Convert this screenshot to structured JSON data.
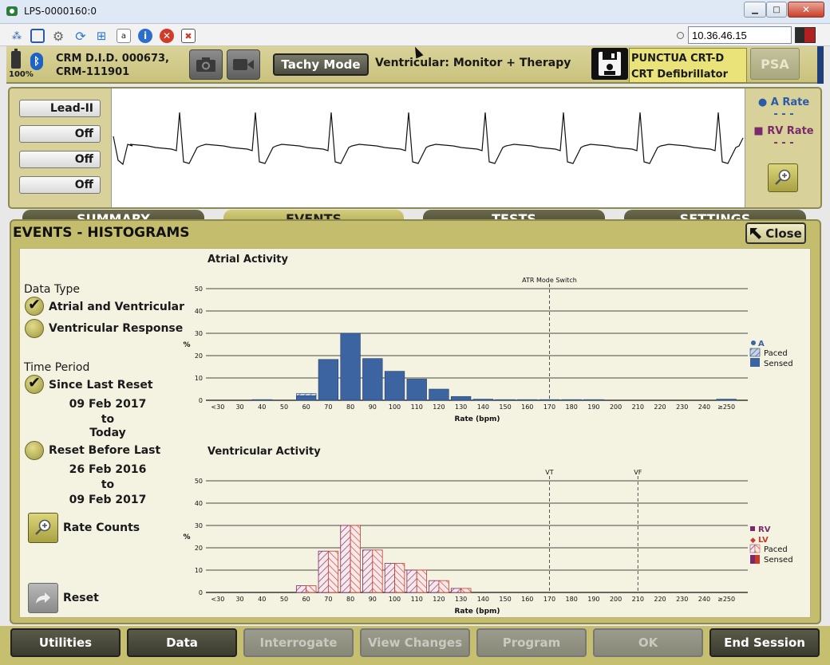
{
  "window": {
    "title": "LPS-0000160:0",
    "min": "▁",
    "max": "□",
    "close": "✕"
  },
  "toolbar": {
    "ip": "10.36.46.15"
  },
  "header": {
    "battery_pct": "100%",
    "device_id_line1": "CRM D.I.D. 000673,",
    "device_id_line2": "CRM-111901",
    "tachy_mode": "Tachy Mode",
    "ventricular_mode": "Ventricular: Monitor + Therapy",
    "device_name": "PUNCTUA CRT-D",
    "device_type": "CRT Defibrillator",
    "psa": "PSA"
  },
  "ecg": {
    "leads": [
      "Lead-II",
      "Off",
      "Off",
      "Off"
    ],
    "a_rate_label": "A Rate",
    "a_rate_value": "- - -",
    "rv_rate_label": "RV Rate",
    "rv_rate_value": "- - -"
  },
  "tabs": [
    {
      "label": "SUMMARY",
      "active": false
    },
    {
      "label": "EVENTS",
      "active": true
    },
    {
      "label": "TESTS",
      "active": false
    },
    {
      "label": "SETTINGS",
      "active": false
    }
  ],
  "events": {
    "title": "EVENTS - HISTOGRAMS",
    "close": "Close",
    "data_type_label": "Data Type",
    "opt_atrial_ventricular": "Atrial and Ventricular",
    "opt_ventricular_response": "Ventricular Response",
    "time_period_label": "Time Period",
    "opt_since_last_reset": "Since Last Reset",
    "since_from": "09 Feb 2017",
    "since_to_word": "to",
    "since_to": "Today",
    "opt_reset_before_last": "Reset Before Last",
    "before_from": "26 Feb 2016",
    "before_to_word": "to",
    "before_to": "09 Feb 2017",
    "rate_counts": "Rate Counts",
    "reset": "Reset"
  },
  "bottom": {
    "utilities": "Utilities",
    "data": "Data",
    "interrogate": "Interrogate",
    "view_changes": "View Changes",
    "program": "Program",
    "ok": "OK",
    "end_session": "End Session"
  },
  "colors": {
    "sensed": "#3c64a0",
    "rv": "#7a2a6a",
    "lv": "#c83a2a",
    "panel": "#c3bd6d"
  },
  "chart_data": [
    {
      "type": "bar",
      "title": "Atrial Activity",
      "xlabel": "Rate (bpm)",
      "ylabel": "%",
      "ylim": [
        0,
        50
      ],
      "yticks": [
        0,
        10,
        20,
        30,
        40,
        50
      ],
      "categories": [
        "<30",
        "30",
        "40",
        "50",
        "60",
        "70",
        "80",
        "90",
        "100",
        "110",
        "120",
        "130",
        "140",
        "150",
        "160",
        "170",
        "180",
        "190",
        "200",
        "210",
        "220",
        "230",
        "240",
        "≥250"
      ],
      "annotations": [
        {
          "label": "ATR Mode Switch",
          "at": "170"
        }
      ],
      "legend": {
        "title": "A",
        "entries": [
          "Paced",
          "Sensed"
        ]
      },
      "series": [
        {
          "name": "Paced",
          "values": [
            0,
            0,
            0,
            0,
            1,
            0,
            0,
            0,
            0,
            0,
            0,
            0,
            0,
            0,
            0,
            0,
            0,
            0,
            0,
            0,
            0,
            0,
            0,
            0
          ]
        },
        {
          "name": "Sensed",
          "values": [
            0,
            0,
            0.3,
            0,
            2,
            18.3,
            30,
            18.7,
            13,
            9.5,
            5,
            1.7,
            0.5,
            0.3,
            0.3,
            0.3,
            0.3,
            0.3,
            0,
            0,
            0,
            0,
            0,
            0.5
          ]
        }
      ]
    },
    {
      "type": "bar",
      "title": "Ventricular Activity",
      "xlabel": "Rate (bpm)",
      "ylabel": "%",
      "ylim": [
        0,
        50
      ],
      "yticks": [
        0,
        10,
        20,
        30,
        40,
        50
      ],
      "categories": [
        "<30",
        "30",
        "40",
        "50",
        "60",
        "70",
        "80",
        "90",
        "100",
        "110",
        "120",
        "130",
        "140",
        "150",
        "160",
        "170",
        "180",
        "190",
        "200",
        "210",
        "220",
        "230",
        "240",
        "≥250"
      ],
      "annotations": [
        {
          "label": "VT",
          "at": "170"
        },
        {
          "label": "VF",
          "at": "210"
        }
      ],
      "legend": {
        "title_rv": "RV",
        "title_lv": "LV",
        "entries": [
          "Paced",
          "Sensed"
        ]
      },
      "series": [
        {
          "name": "Paced",
          "values": [
            0,
            0,
            0,
            0,
            3,
            18.5,
            30,
            19,
            13,
            10,
            5.3,
            1.8,
            0,
            0,
            0,
            0,
            0,
            0,
            0,
            0,
            0,
            0,
            0,
            0
          ]
        }
      ]
    }
  ]
}
